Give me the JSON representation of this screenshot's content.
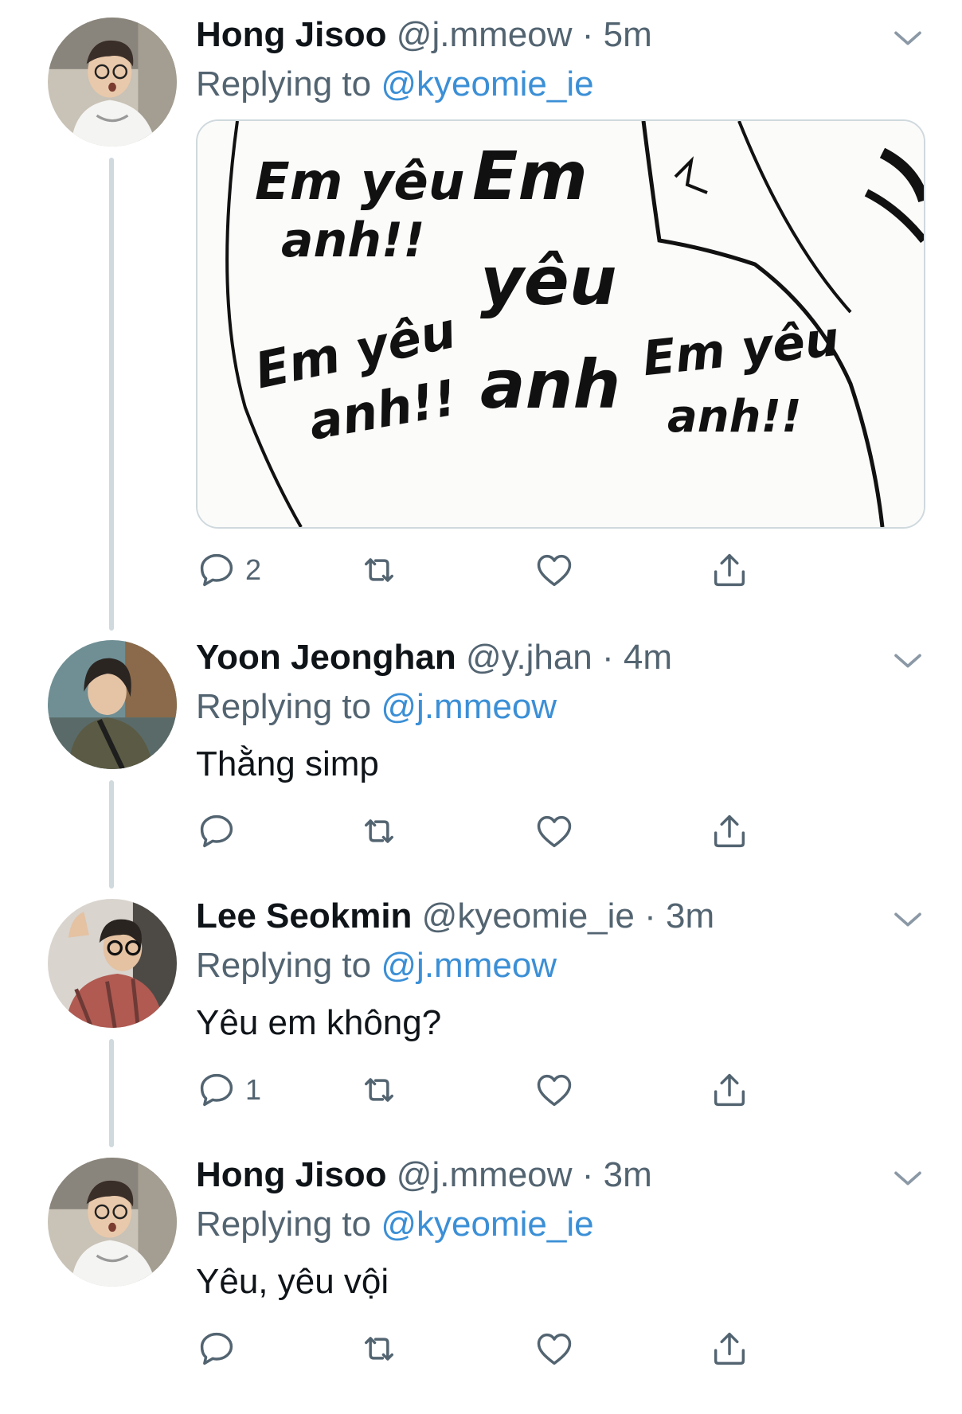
{
  "tweets": [
    {
      "name": "Hong Jisoo",
      "handle": "@j.mmeow",
      "dot": "·",
      "time": "5m",
      "replying_prefix": "Replying to",
      "replying_to": "@kyeomie_ie",
      "text": "",
      "has_media": true,
      "media_words": [
        "Em yêu",
        "anh!!",
        "Em",
        "yêu",
        "Em yêu",
        "anh!!",
        "anh",
        "Em yêu",
        "anh!!"
      ],
      "reply_count": "2",
      "retweet_count": "",
      "like_count": ""
    },
    {
      "name": "Yoon Jeonghan",
      "handle": "@y.jhan",
      "dot": "·",
      "time": "4m",
      "replying_prefix": "Replying to",
      "replying_to": "@j.mmeow",
      "text": "Thằng simp",
      "has_media": false,
      "reply_count": "",
      "retweet_count": "",
      "like_count": ""
    },
    {
      "name": "Lee Seokmin",
      "handle": "@kyeomie_ie",
      "dot": "·",
      "time": "3m",
      "replying_prefix": "Replying to",
      "replying_to": "@j.mmeow",
      "text": "Yêu em không?",
      "has_media": false,
      "reply_count": "1",
      "retweet_count": "",
      "like_count": ""
    },
    {
      "name": "Hong Jisoo",
      "handle": "@j.mmeow",
      "dot": "·",
      "time": "3m",
      "replying_prefix": "Replying to",
      "replying_to": "@kyeomie_ie",
      "text": "Yêu, yêu vội",
      "has_media": false,
      "reply_count": "",
      "retweet_count": "",
      "like_count": ""
    }
  ],
  "icons": {
    "more": "chevron-down-icon",
    "reply": "reply-icon",
    "retweet": "retweet-icon",
    "like": "heart-icon",
    "share": "share-icon"
  },
  "colors": {
    "text": "#0f1419",
    "secondary": "#536471",
    "mention": "#3b8fd6",
    "thread_line": "#cfd9de"
  }
}
